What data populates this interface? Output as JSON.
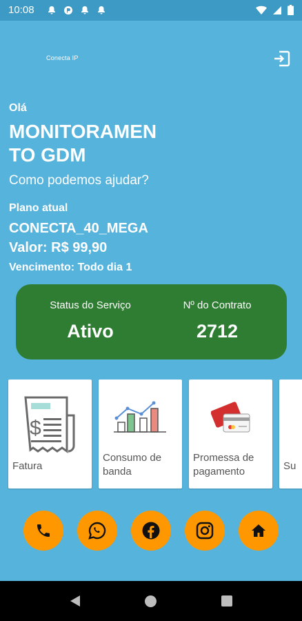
{
  "status_bar": {
    "time": "10:08"
  },
  "header": {
    "logo_text": "Conecta IP"
  },
  "greeting": {
    "hello": "Olá",
    "name": "MONITORAMENTO GDM",
    "prompt": "Como podemos ajudar?"
  },
  "plan": {
    "label": "Plano atual",
    "name": "CONECTA_40_MEGA",
    "value": "Valor: R$ 99,90",
    "due": "Vencimento: Todo dia 1"
  },
  "status_card": {
    "service_label": "Status do Serviço",
    "service_value": "Ativo",
    "contract_label": "Nº do Contrato",
    "contract_value": "2712",
    "color": "#2e7d32"
  },
  "cards": [
    {
      "label": "Fatura",
      "icon": "invoice-icon"
    },
    {
      "label": "Consumo de banda",
      "icon": "chart-icon"
    },
    {
      "label": "Promessa de pagamento",
      "icon": "credit-card-icon"
    },
    {
      "label": "Su",
      "icon": ""
    }
  ],
  "social": [
    {
      "name": "phone-icon"
    },
    {
      "name": "whatsapp-icon"
    },
    {
      "name": "facebook-icon"
    },
    {
      "name": "instagram-icon"
    },
    {
      "name": "home-icon"
    }
  ],
  "colors": {
    "background": "#56b3dc",
    "accent": "#ff9800",
    "status_green": "#2e7d32"
  }
}
